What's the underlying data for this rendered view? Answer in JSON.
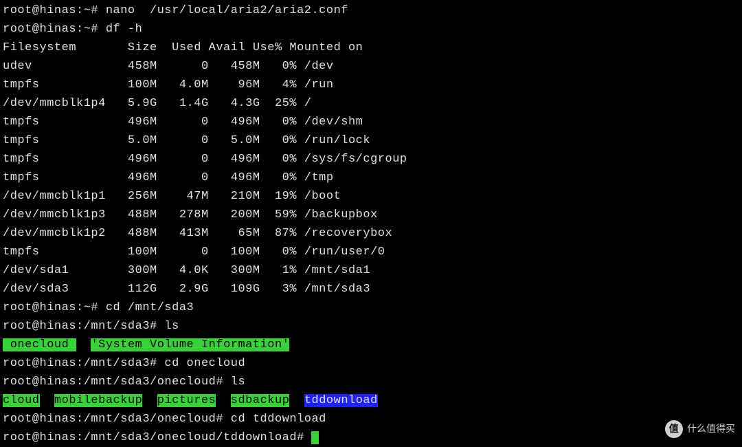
{
  "lines": [
    {
      "type": "cmd",
      "prompt": "root@hinas:~#",
      "cmd": " nano  /usr/local/aria2/aria2.conf"
    },
    {
      "type": "cmd",
      "prompt": "root@hinas:~#",
      "cmd": " df -h"
    }
  ],
  "df": {
    "header": {
      "fs": "Filesystem",
      "size": "Size",
      "used": "Used",
      "avail": "Avail",
      "pct": "Use%",
      "mnt": "Mounted on"
    },
    "rows": [
      {
        "fs": "udev",
        "size": "458M",
        "used": "0",
        "avail": "458M",
        "pct": "0%",
        "mnt": "/dev"
      },
      {
        "fs": "tmpfs",
        "size": "100M",
        "used": "4.0M",
        "avail": "96M",
        "pct": "4%",
        "mnt": "/run"
      },
      {
        "fs": "/dev/mmcblk1p4",
        "size": "5.9G",
        "used": "1.4G",
        "avail": "4.3G",
        "pct": "25%",
        "mnt": "/"
      },
      {
        "fs": "tmpfs",
        "size": "496M",
        "used": "0",
        "avail": "496M",
        "pct": "0%",
        "mnt": "/dev/shm"
      },
      {
        "fs": "tmpfs",
        "size": "5.0M",
        "used": "0",
        "avail": "5.0M",
        "pct": "0%",
        "mnt": "/run/lock"
      },
      {
        "fs": "tmpfs",
        "size": "496M",
        "used": "0",
        "avail": "496M",
        "pct": "0%",
        "mnt": "/sys/fs/cgroup"
      },
      {
        "fs": "tmpfs",
        "size": "496M",
        "used": "0",
        "avail": "496M",
        "pct": "0%",
        "mnt": "/tmp"
      },
      {
        "fs": "/dev/mmcblk1p1",
        "size": "256M",
        "used": "47M",
        "avail": "210M",
        "pct": "19%",
        "mnt": "/boot"
      },
      {
        "fs": "/dev/mmcblk1p3",
        "size": "488M",
        "used": "278M",
        "avail": "200M",
        "pct": "59%",
        "mnt": "/backupbox"
      },
      {
        "fs": "/dev/mmcblk1p2",
        "size": "488M",
        "used": "413M",
        "avail": "65M",
        "pct": "87%",
        "mnt": "/recoverybox"
      },
      {
        "fs": "tmpfs",
        "size": "100M",
        "used": "0",
        "avail": "100M",
        "pct": "0%",
        "mnt": "/run/user/0"
      },
      {
        "fs": "/dev/sda1",
        "size": "300M",
        "used": "4.0K",
        "avail": "300M",
        "pct": "1%",
        "mnt": "/mnt/sda1"
      },
      {
        "fs": "/dev/sda3",
        "size": "112G",
        "used": "2.9G",
        "avail": "109G",
        "pct": "3%",
        "mnt": "/mnt/sda3"
      }
    ]
  },
  "cmds2": [
    {
      "prompt": "root@hinas:~#",
      "cmd": " cd /mnt/sda3"
    },
    {
      "prompt": "root@hinas:/mnt/sda3#",
      "cmd": " ls"
    }
  ],
  "ls1": {
    "items": [
      {
        "text": " onecloud ",
        "style": "hl-green"
      },
      {
        "text": "  "
      },
      {
        "text": "'System Volume Information'",
        "style": "hl-green"
      }
    ]
  },
  "cmds3": [
    {
      "prompt": "root@hinas:/mnt/sda3#",
      "cmd": " cd onecloud"
    },
    {
      "prompt": "root@hinas:/mnt/sda3/onecloud#",
      "cmd": " ls"
    }
  ],
  "ls2": {
    "items": [
      {
        "text": "cloud",
        "style": "hl-green"
      },
      {
        "text": "  "
      },
      {
        "text": "mobilebackup",
        "style": "hl-green"
      },
      {
        "text": "  "
      },
      {
        "text": "pictures",
        "style": "hl-green"
      },
      {
        "text": "  "
      },
      {
        "text": "sdbackup",
        "style": "hl-green"
      },
      {
        "text": "  "
      },
      {
        "text": "tddownload",
        "style": "hl-blue"
      }
    ]
  },
  "cmds4": [
    {
      "prompt": "root@hinas:/mnt/sda3/onecloud#",
      "cmd": " cd tddownload"
    },
    {
      "prompt": "root@hinas:/mnt/sda3/onecloud/tddownload#",
      "cmd": " ",
      "cursor": true
    }
  ],
  "watermark": {
    "badge": "值",
    "text": "什么值得买"
  }
}
